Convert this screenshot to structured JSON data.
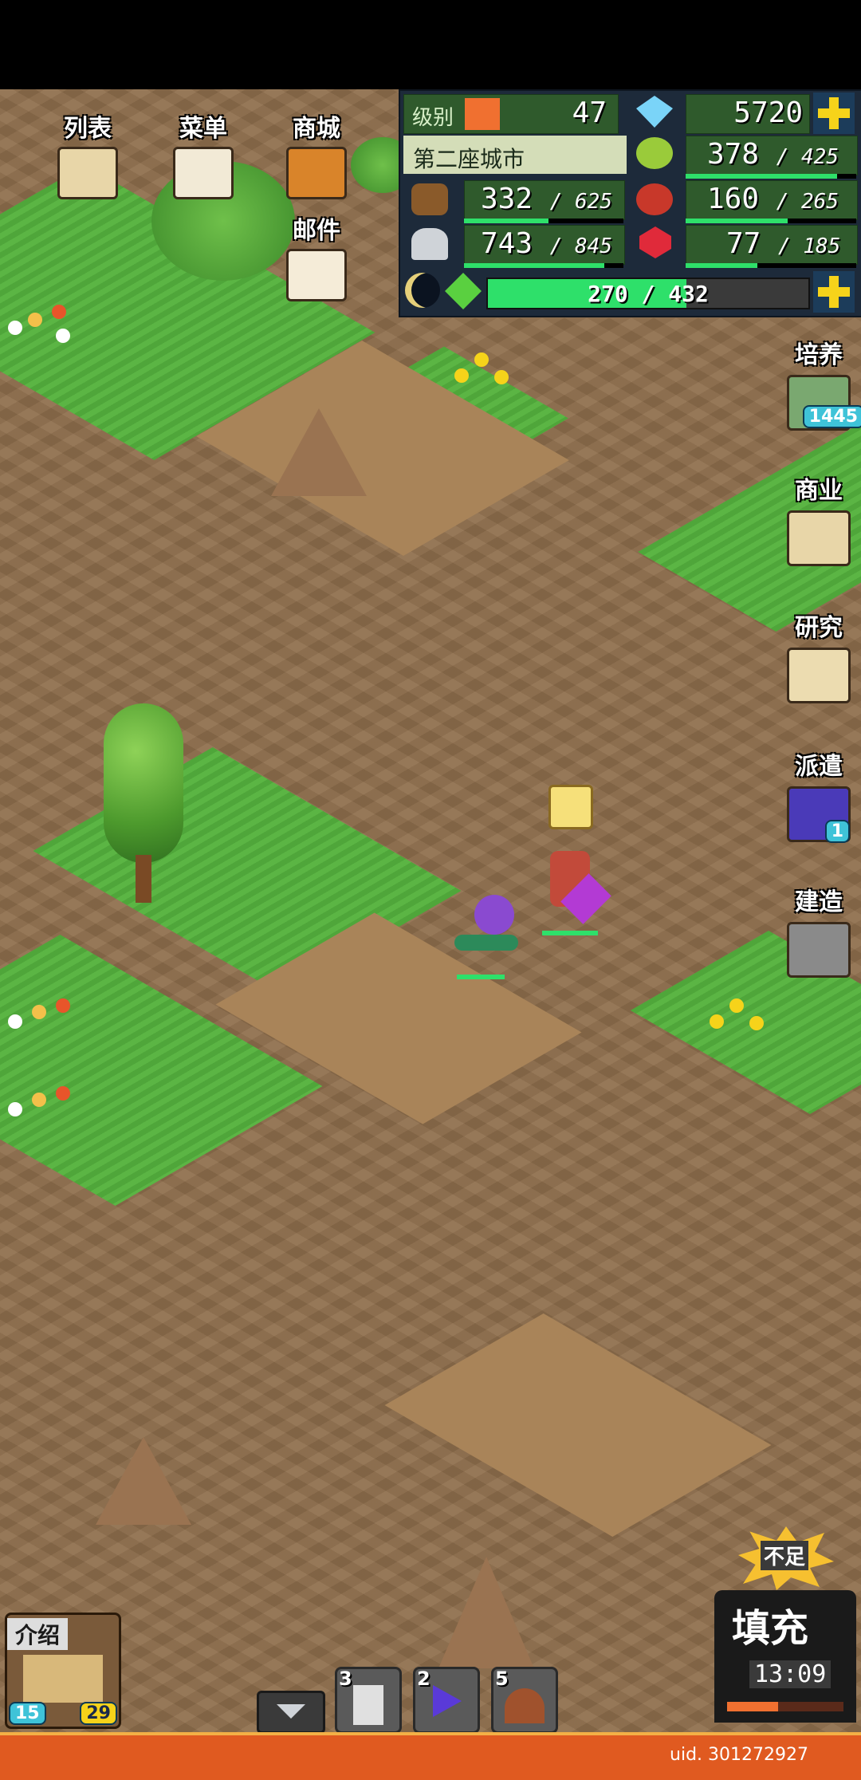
{
  "top_left": {
    "list_label": "列表",
    "menu_label": "菜单",
    "shop_label": "商城",
    "mail_label": "邮件"
  },
  "resources": {
    "level_label": "级别",
    "level_value": "47",
    "gems": "5720",
    "city_name": "第二座城市",
    "food": {
      "value": "378",
      "cap": "/ 425"
    },
    "wood": {
      "value": "332",
      "cap": "/ 625"
    },
    "produce": {
      "value": "160",
      "cap": "/ 265"
    },
    "stone": {
      "value": "743",
      "cap": "/ 845"
    },
    "ruby": {
      "value": "77",
      "cap": "/ 185"
    },
    "energy": {
      "value": "270 / 432"
    }
  },
  "right_menu": {
    "train_label": "培养",
    "train_badge": "1445",
    "business_label": "商业",
    "research_label": "研究",
    "dispatch_label": "派遣",
    "dispatch_badge": "1",
    "build_label": "建造"
  },
  "bottom": {
    "intro_label": "介绍",
    "intro_left_count": "15",
    "intro_right_count": "29",
    "slot1_count": "3",
    "slot2_count": "2",
    "slot3_count": "5",
    "fill_badge": "不足",
    "fill_label": "填充",
    "fill_timer": "13:09",
    "uid": "uid. 301272927"
  },
  "colors": {
    "grass": "#4fa63a",
    "dirt": "#8f6f4d",
    "accent_yellow": "#f6d31a",
    "energy_green": "#2ee06a"
  }
}
